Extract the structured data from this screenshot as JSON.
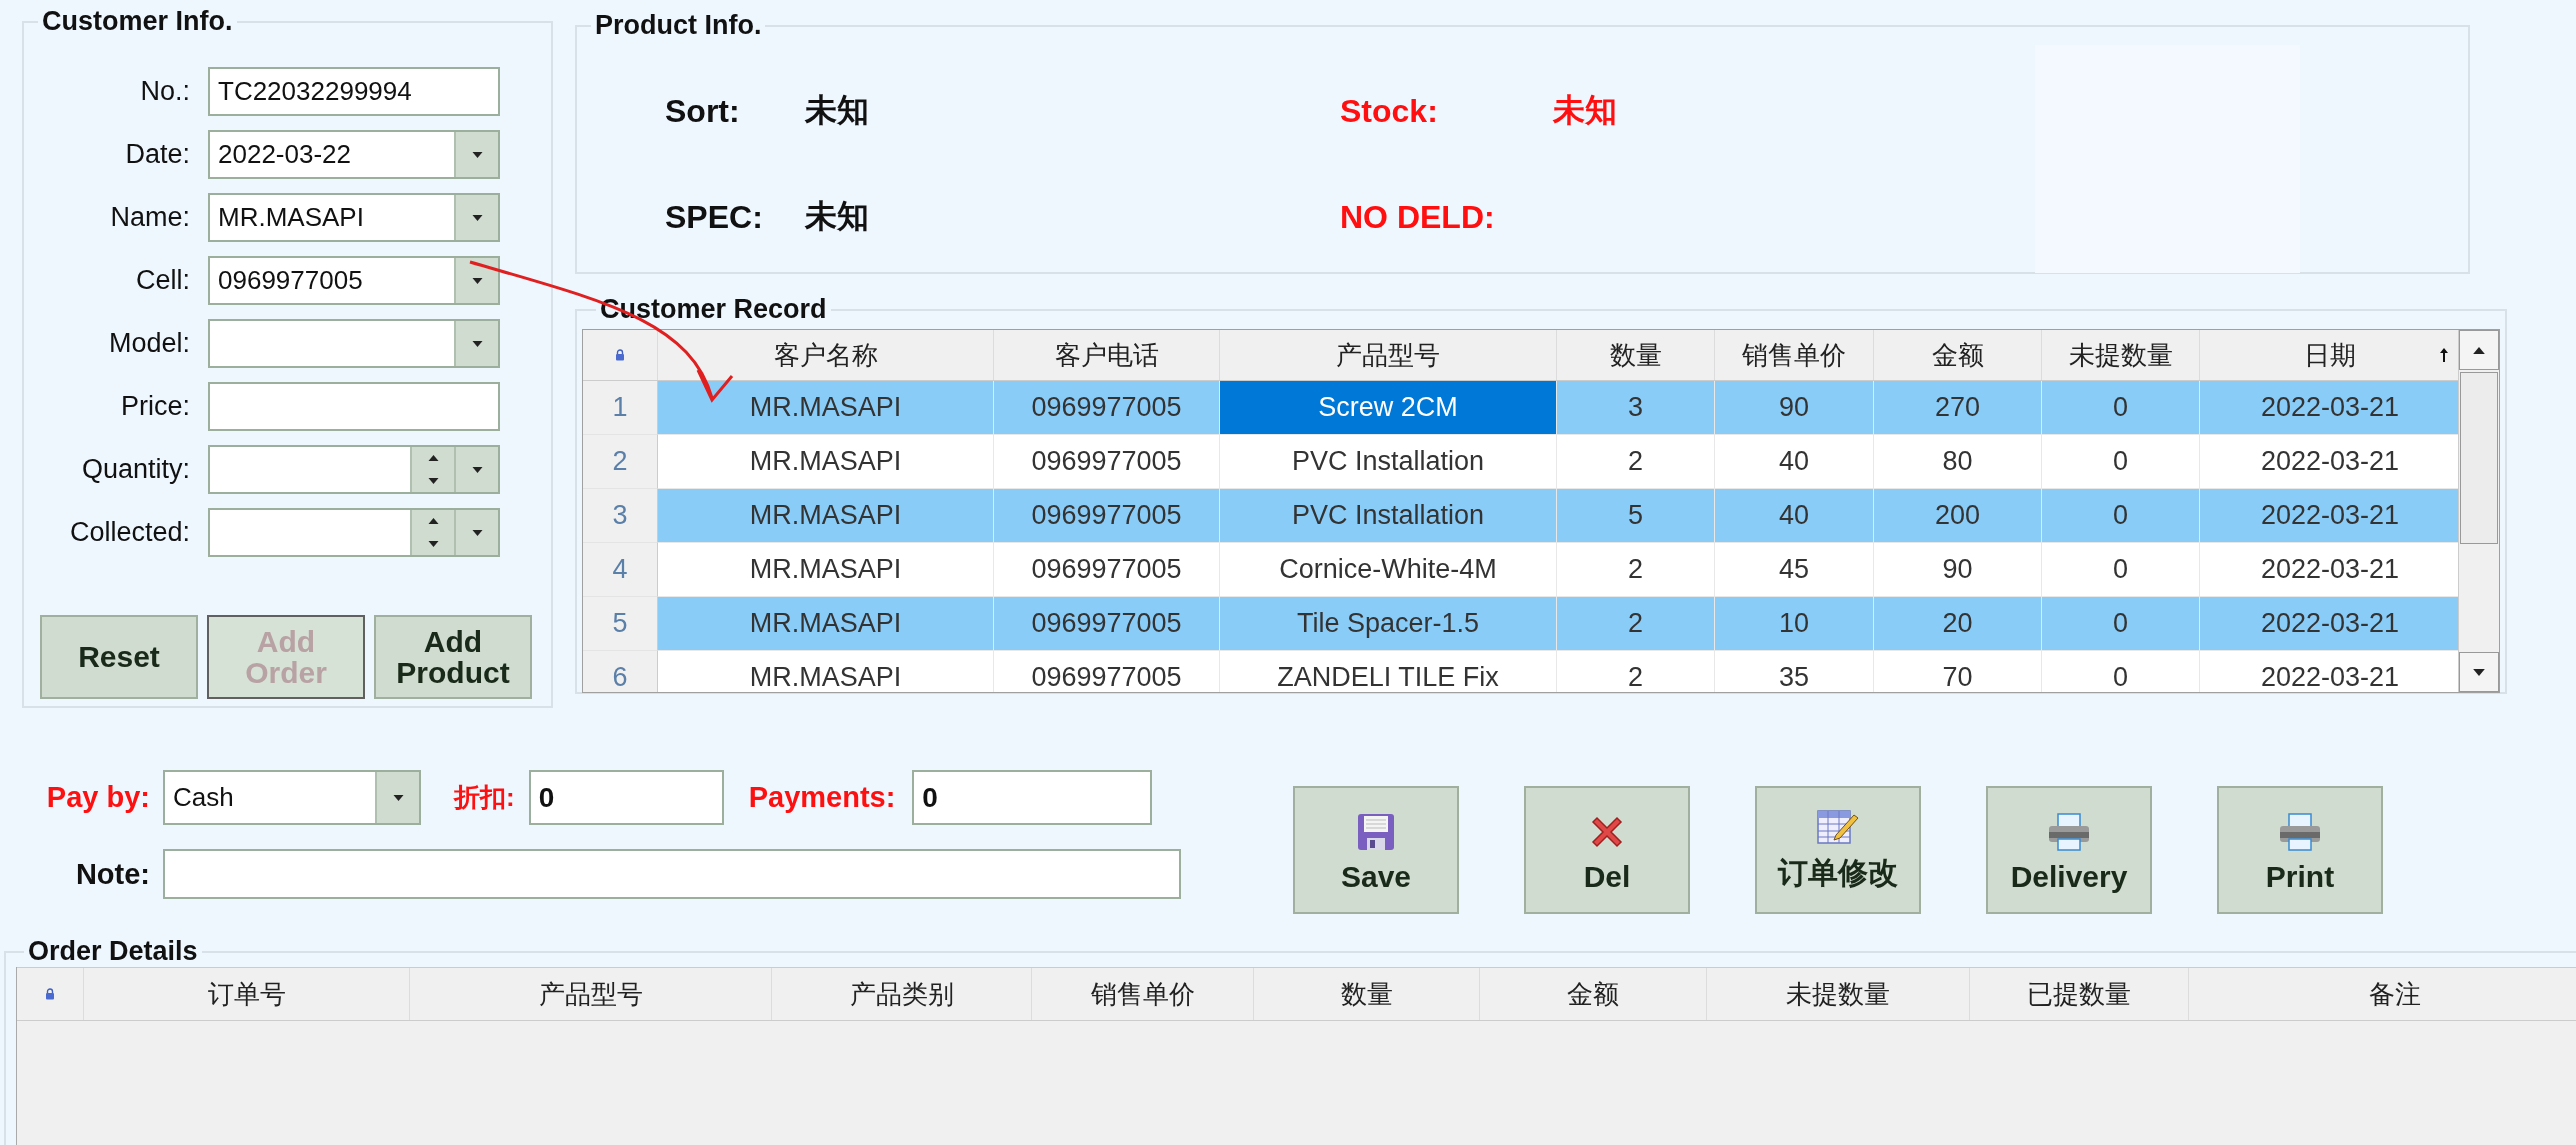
{
  "customer_info": {
    "title": "Customer Info.",
    "fields": [
      {
        "label": "No.:",
        "kind": "text",
        "value": "TC22032299994"
      },
      {
        "label": "Date:",
        "kind": "dropdown",
        "value": "2022-03-22"
      },
      {
        "label": "Name:",
        "kind": "dropdown",
        "value": "MR.MASAPI"
      },
      {
        "label": "Cell:",
        "kind": "dropdown",
        "value": "0969977005"
      },
      {
        "label": "Model:",
        "kind": "dropdown"
      },
      {
        "label": "Price:",
        "kind": "text"
      },
      {
        "label": "Quantity:",
        "kind": "spin"
      },
      {
        "label": "Collected:",
        "kind": "spin"
      }
    ],
    "buttons": [
      {
        "label": "Reset",
        "disabled": false
      },
      {
        "label": "Add Order",
        "disabled": true
      },
      {
        "label": "Add Product",
        "disabled": false
      }
    ]
  },
  "product_info": {
    "title": "Product Info.",
    "items": [
      {
        "label": "Sort:",
        "kind": "normal",
        "value": "未知"
      },
      {
        "label": "Stock:",
        "kind": "alert",
        "value": "未知"
      },
      {
        "label": "SPEC:",
        "kind": "normal",
        "value": "未知"
      },
      {
        "label": "NO DELD:",
        "kind": "alert"
      }
    ]
  },
  "customer_record": {
    "title": "Customer Record",
    "columns": [
      {
        "label": "客户名称",
        "sorted": false
      },
      {
        "label": "客户电话",
        "sorted": false
      },
      {
        "label": "产品型号",
        "sorted": false
      },
      {
        "label": "数量",
        "sorted": false
      },
      {
        "label": "销售单价",
        "sorted": false
      },
      {
        "label": "金额",
        "sorted": false
      },
      {
        "label": "未提数量",
        "sorted": false
      },
      {
        "label": "日期",
        "sorted": true
      }
    ],
    "rows": [
      {
        "no": "1",
        "selected": true,
        "cells": [
          {
            "text": "MR.MASAPI",
            "focused": false
          },
          {
            "text": "0969977005",
            "focused": false
          },
          {
            "text": "Screw 2CM",
            "focused": true
          },
          {
            "text": "3",
            "focused": false
          },
          {
            "text": "90",
            "focused": false
          },
          {
            "text": "270",
            "focused": false
          },
          {
            "text": "0",
            "focused": false
          },
          {
            "text": "2022-03-21",
            "focused": false
          }
        ]
      },
      {
        "no": "2",
        "selected": false,
        "cells": [
          {
            "text": "MR.MASAPI",
            "focused": false
          },
          {
            "text": "0969977005",
            "focused": false
          },
          {
            "text": "PVC Installation",
            "focused": false
          },
          {
            "text": "2",
            "focused": false
          },
          {
            "text": "40",
            "focused": false
          },
          {
            "text": "80",
            "focused": false
          },
          {
            "text": "0",
            "focused": false
          },
          {
            "text": "2022-03-21",
            "focused": false
          }
        ]
      },
      {
        "no": "3",
        "selected": true,
        "cells": [
          {
            "text": "MR.MASAPI",
            "focused": false
          },
          {
            "text": "0969977005",
            "focused": false
          },
          {
            "text": "PVC Installation",
            "focused": false
          },
          {
            "text": "5",
            "focused": false
          },
          {
            "text": "40",
            "focused": false
          },
          {
            "text": "200",
            "focused": false
          },
          {
            "text": "0",
            "focused": false
          },
          {
            "text": "2022-03-21",
            "focused": false
          }
        ]
      },
      {
        "no": "4",
        "selected": false,
        "cells": [
          {
            "text": "MR.MASAPI",
            "focused": false
          },
          {
            "text": "0969977005",
            "focused": false
          },
          {
            "text": "Cornice-White-4M",
            "focused": false
          },
          {
            "text": "2",
            "focused": false
          },
          {
            "text": "45",
            "focused": false
          },
          {
            "text": "90",
            "focused": false
          },
          {
            "text": "0",
            "focused": false
          },
          {
            "text": "2022-03-21",
            "focused": false
          }
        ]
      },
      {
        "no": "5",
        "selected": true,
        "cells": [
          {
            "text": "MR.MASAPI",
            "focused": false
          },
          {
            "text": "0969977005",
            "focused": false
          },
          {
            "text": "Tile Spacer-1.5",
            "focused": false
          },
          {
            "text": "2",
            "focused": false
          },
          {
            "text": "10",
            "focused": false
          },
          {
            "text": "20",
            "focused": false
          },
          {
            "text": "0",
            "focused": false
          },
          {
            "text": "2022-03-21",
            "focused": false
          }
        ]
      },
      {
        "no": "6",
        "selected": false,
        "cells": [
          {
            "text": "MR.MASAPI",
            "focused": false
          },
          {
            "text": "0969977005",
            "focused": false
          },
          {
            "text": "ZANDELI TILE Fix",
            "focused": false
          },
          {
            "text": "2",
            "focused": false
          },
          {
            "text": "35",
            "focused": false
          },
          {
            "text": "70",
            "focused": false
          },
          {
            "text": "0",
            "focused": false
          },
          {
            "text": "2022-03-21",
            "focused": false
          }
        ]
      }
    ]
  },
  "payment": {
    "pay_by": {
      "label": "Pay by:",
      "value": "Cash"
    },
    "discount": {
      "label": "折扣:",
      "value": "0"
    },
    "payments": {
      "label": "Payments:",
      "value": "0"
    },
    "note": {
      "label": "Note:"
    }
  },
  "actions": [
    {
      "label": "Save",
      "kind": "save"
    },
    {
      "label": "Del",
      "kind": "delete"
    },
    {
      "label": "订单修改",
      "kind": "edit"
    },
    {
      "label": "Delivery",
      "kind": "print"
    },
    {
      "label": "Print",
      "kind": "print"
    }
  ],
  "order_details": {
    "title": "Order Details",
    "columns": [
      {
        "label": "订单号"
      },
      {
        "label": "产品型号"
      },
      {
        "label": "产品类别"
      },
      {
        "label": "销售单价"
      },
      {
        "label": "数量"
      },
      {
        "label": "金额"
      },
      {
        "label": "未提数量"
      },
      {
        "label": "已提数量"
      },
      {
        "label": "备注"
      }
    ]
  }
}
